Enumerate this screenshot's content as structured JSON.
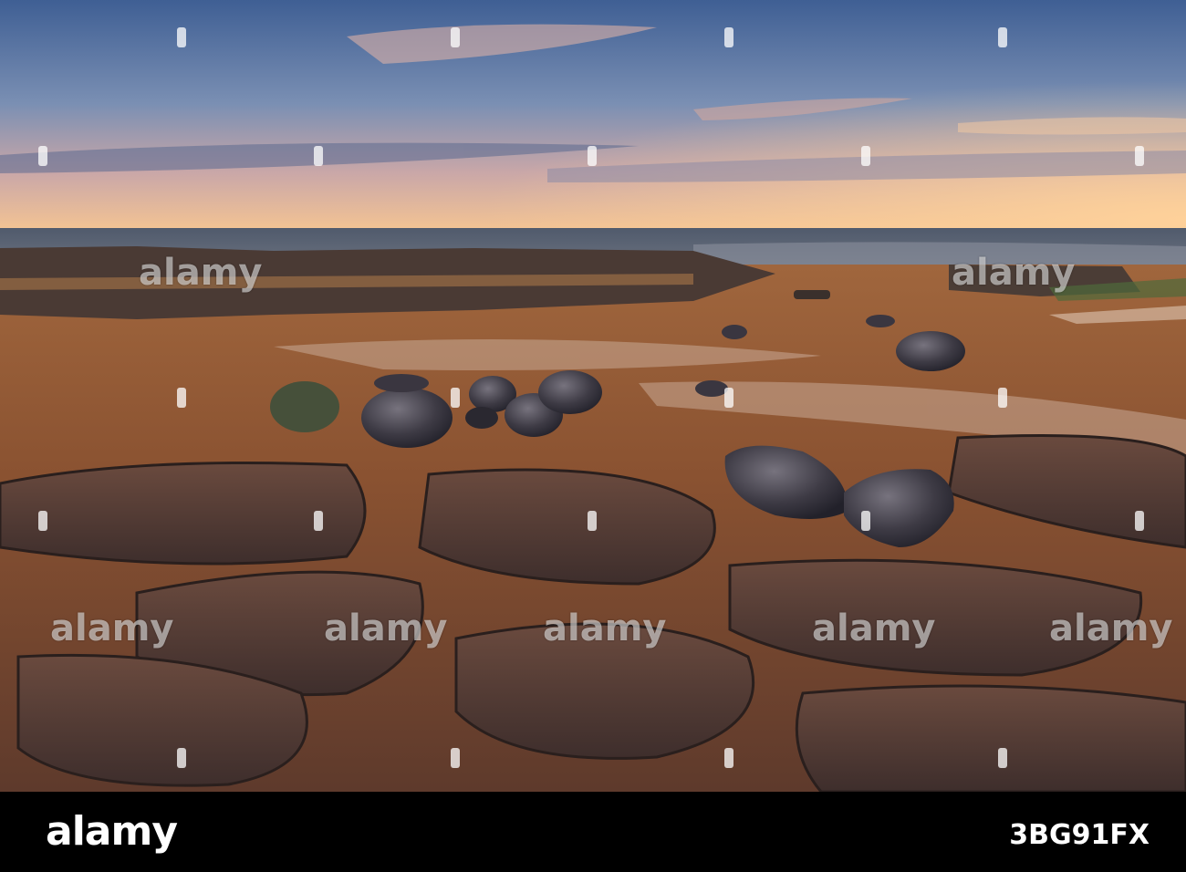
{
  "watermark": {
    "text": "alamy"
  },
  "footer": {
    "logo": "alamy",
    "image_id": "3BG91FX"
  },
  "colors": {
    "sky_top": "#4a6796",
    "horizon_glow": "#f7c489",
    "sea": "#3e4a5c",
    "sand": "#8c5532",
    "rock": "#3a3640"
  }
}
